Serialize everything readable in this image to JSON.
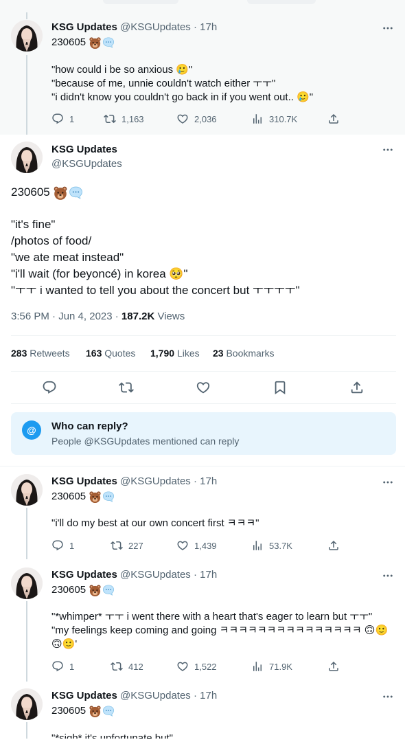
{
  "account": {
    "name": "KSG Updates",
    "handle": "@KSGUpdates",
    "age": "17h",
    "separator": "·"
  },
  "tweets": [
    {
      "date": "230605",
      "lines": [
        "\"how could i be so anxious 🥲\"",
        "\"because of me, unnie couldn't watch either ㅜㅜ\"",
        "\"i didn't know you couldn't go back in if you went out.. 🥲\""
      ],
      "replies": "1",
      "retweets": "1,163",
      "likes": "2,036",
      "views": "310.7K"
    },
    {
      "date": "230605",
      "lines": [
        "\"i'll do my best at our own concert first ㅋㅋㅋ\""
      ],
      "replies": "1",
      "retweets": "227",
      "likes": "1,439",
      "views": "53.7K"
    },
    {
      "date": "230605",
      "lines": [
        "\"*whimper* ㅜㅜ i went there with a heart that's eager to learn but ㅜㅜ\"",
        "\"my feelings keep coming and going ㅋㅋㅋㅋㅋㅋㅋㅋㅋㅋㅋㅋㅋㅋㅋ 🙃🙂",
        "🙃🙂'"
      ],
      "replies": "1",
      "retweets": "412",
      "likes": "1,522",
      "views": "71.9K"
    },
    {
      "date": "230605",
      "lines": [
        "\"*sigh* it's unfortunate but\""
      ]
    }
  ],
  "main_tweet": {
    "date": "230605",
    "lines": [
      "\"it's fine\"",
      "/photos of food/",
      "\"we ate meat instead\"",
      "\"i'll wait (for beyoncé) in korea 🥺\"",
      "\"ㅜㅜ i wanted to tell you about the concert but ㅜㅜㅜㅜ\""
    ],
    "time": "3:56 PM · Jun 4, 2023 · ",
    "views_count": "187.2K",
    "views_label": " Views",
    "stats": {
      "retweets": "283",
      "retweets_label": "Retweets",
      "quotes": "163",
      "quotes_label": "Quotes",
      "likes": "1,790",
      "likes_label": "Likes",
      "bookmarks": "23",
      "bookmarks_label": "Bookmarks"
    }
  },
  "who_can_reply": {
    "badge": "@",
    "title": "Who can reply?",
    "subtitle": "People @KSGUpdates mentioned can reply"
  },
  "colors": {
    "accent": "#1d9bf0",
    "muted": "#536471",
    "text": "#0f1419",
    "reply_box": "#e8f5fd"
  },
  "icons": [
    "bear-emoji-icon",
    "speech-bubble-icon",
    "reply-icon",
    "retweet-icon",
    "like-icon",
    "views-icon",
    "share-icon",
    "bookmark-icon",
    "more-icon"
  ]
}
